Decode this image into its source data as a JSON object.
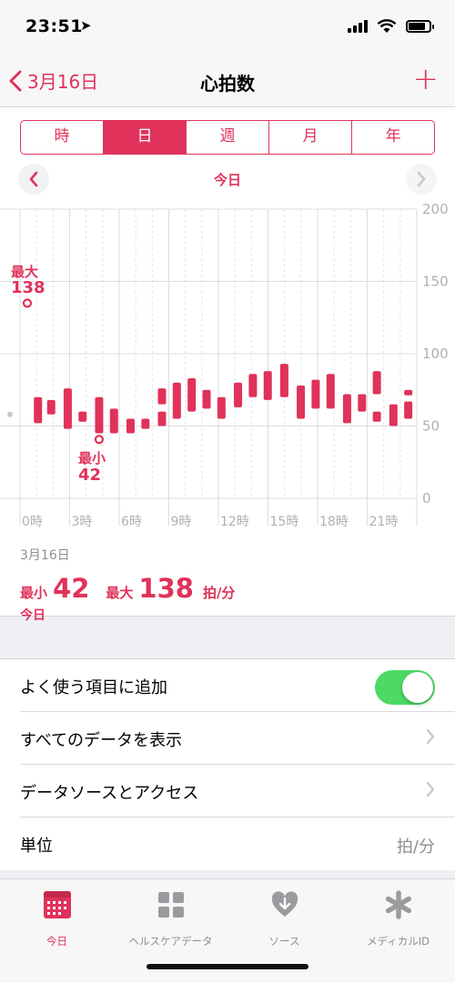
{
  "status": {
    "time": "23:51",
    "location_icon": "location-arrow-icon"
  },
  "nav": {
    "back_label": "3月16日",
    "title": "心拍数",
    "add_icon": "plus-icon"
  },
  "segments": [
    {
      "label": "時",
      "active": false
    },
    {
      "label": "日",
      "active": true
    },
    {
      "label": "週",
      "active": false
    },
    {
      "label": "月",
      "active": false
    },
    {
      "label": "年",
      "active": false
    }
  ],
  "date_label": "今日",
  "chart_data": {
    "type": "range-bar",
    "y_ticks": [
      "200",
      "150",
      "100",
      "50",
      "0"
    ],
    "ylim": [
      0,
      200
    ],
    "x_ticks": [
      "0時",
      "3時",
      "6時",
      "9時",
      "12時",
      "15時",
      "18時",
      "21時"
    ],
    "callouts": {
      "max_label": "最大",
      "max_value": "138",
      "min_label": "最小",
      "min_value": "42"
    },
    "bars": [
      {
        "x": -0.7,
        "low": 135,
        "high": 138,
        "dot": true
      },
      {
        "x": 0.7,
        "low": 52,
        "high": 70
      },
      {
        "x": 1.5,
        "low": 58,
        "high": 68
      },
      {
        "x": 2.5,
        "low": 48,
        "high": 76
      },
      {
        "x": 3.4,
        "low": 53,
        "high": 60
      },
      {
        "x": 4.4,
        "low": 45,
        "high": 70
      },
      {
        "x": 4.4,
        "low": 42,
        "high": 42,
        "dot": true
      },
      {
        "x": 5.3,
        "low": 45,
        "high": 62
      },
      {
        "x": 6.3,
        "low": 45,
        "high": 55
      },
      {
        "x": 7.2,
        "low": 48,
        "high": 55
      },
      {
        "x": 8.2,
        "low": 50,
        "high": 60
      },
      {
        "x": 8.2,
        "low": 65,
        "high": 76
      },
      {
        "x": 9.1,
        "low": 55,
        "high": 80
      },
      {
        "x": 10.0,
        "low": 60,
        "high": 83
      },
      {
        "x": 10.9,
        "low": 62,
        "high": 75
      },
      {
        "x": 11.8,
        "low": 55,
        "high": 70
      },
      {
        "x": 12.8,
        "low": 63,
        "high": 80
      },
      {
        "x": 13.7,
        "low": 70,
        "high": 86
      },
      {
        "x": 14.6,
        "low": 68,
        "high": 88
      },
      {
        "x": 15.6,
        "low": 70,
        "high": 93
      },
      {
        "x": 16.6,
        "low": 55,
        "high": 78
      },
      {
        "x": 17.5,
        "low": 62,
        "high": 82
      },
      {
        "x": 18.4,
        "low": 62,
        "high": 86
      },
      {
        "x": 19.4,
        "low": 52,
        "high": 72
      },
      {
        "x": 20.3,
        "low": 60,
        "high": 72
      },
      {
        "x": 21.2,
        "low": 53,
        "high": 60
      },
      {
        "x": 21.2,
        "low": 72,
        "high": 88
      },
      {
        "x": 22.2,
        "low": 50,
        "high": 65
      },
      {
        "x": 23.1,
        "low": 55,
        "high": 67
      },
      {
        "x": 23.1,
        "low": 72,
        "high": 75
      }
    ]
  },
  "summary": {
    "date": "3月16日",
    "min_label": "最小",
    "min_value": "42",
    "max_label": "最大",
    "max_value": "138",
    "unit": "拍/分",
    "day_label": "今日"
  },
  "settings": {
    "favorite_label": "よく使う項目に追加",
    "favorite_on": true,
    "show_all_label": "すべてのデータを表示",
    "sources_label": "データソースとアクセス",
    "unit_label": "単位",
    "unit_value": "拍/分"
  },
  "tabs": [
    {
      "label": "今日",
      "icon": "calendar-icon",
      "active": true
    },
    {
      "label": "ヘルスケアデータ",
      "icon": "grid-icon",
      "active": false
    },
    {
      "label": "ソース",
      "icon": "heart-download-icon",
      "active": false
    },
    {
      "label": "メディカルID",
      "icon": "asterisk-icon",
      "active": false
    }
  ],
  "colors": {
    "accent": "#e0325a",
    "toggle_on": "#4cd964"
  }
}
